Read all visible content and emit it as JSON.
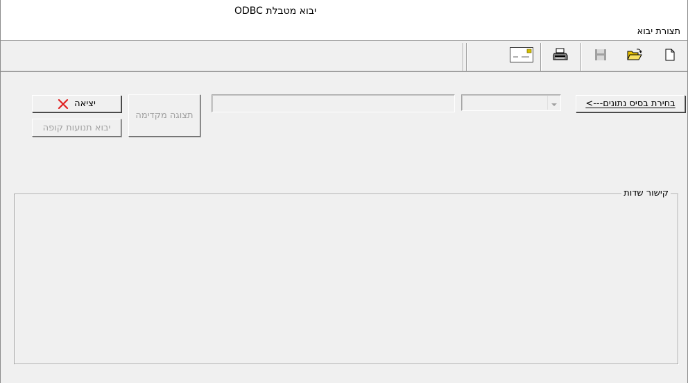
{
  "window": {
    "title": "יבוא מטבלת ODBC"
  },
  "menu": {
    "items": [
      {
        "label": "תצורת יבוא"
      }
    ]
  },
  "toolbar": {
    "buttons": [
      {
        "name": "new",
        "icon": "new-document-icon"
      },
      {
        "name": "open",
        "icon": "open-folder-icon"
      },
      {
        "name": "save",
        "icon": "save-disk-icon",
        "enabled": false
      },
      {
        "name": "print",
        "icon": "printer-icon"
      },
      {
        "name": "email",
        "icon": "envelope-icon"
      }
    ]
  },
  "form": {
    "select_db_label": "בחירת בסיס נתונים--->",
    "db_combo_value": "",
    "db_path_value": "",
    "preview_label": "תצוגה מקדימה",
    "exit_label": "יציאה",
    "import_cash_label": "יבוא תנועות קופה",
    "field_mapping_label": "קישור שדות"
  },
  "colors": {
    "window_bg": "#f0f0f0",
    "disabled_text": "#a0a0a0",
    "exit_icon": "#e02020"
  }
}
